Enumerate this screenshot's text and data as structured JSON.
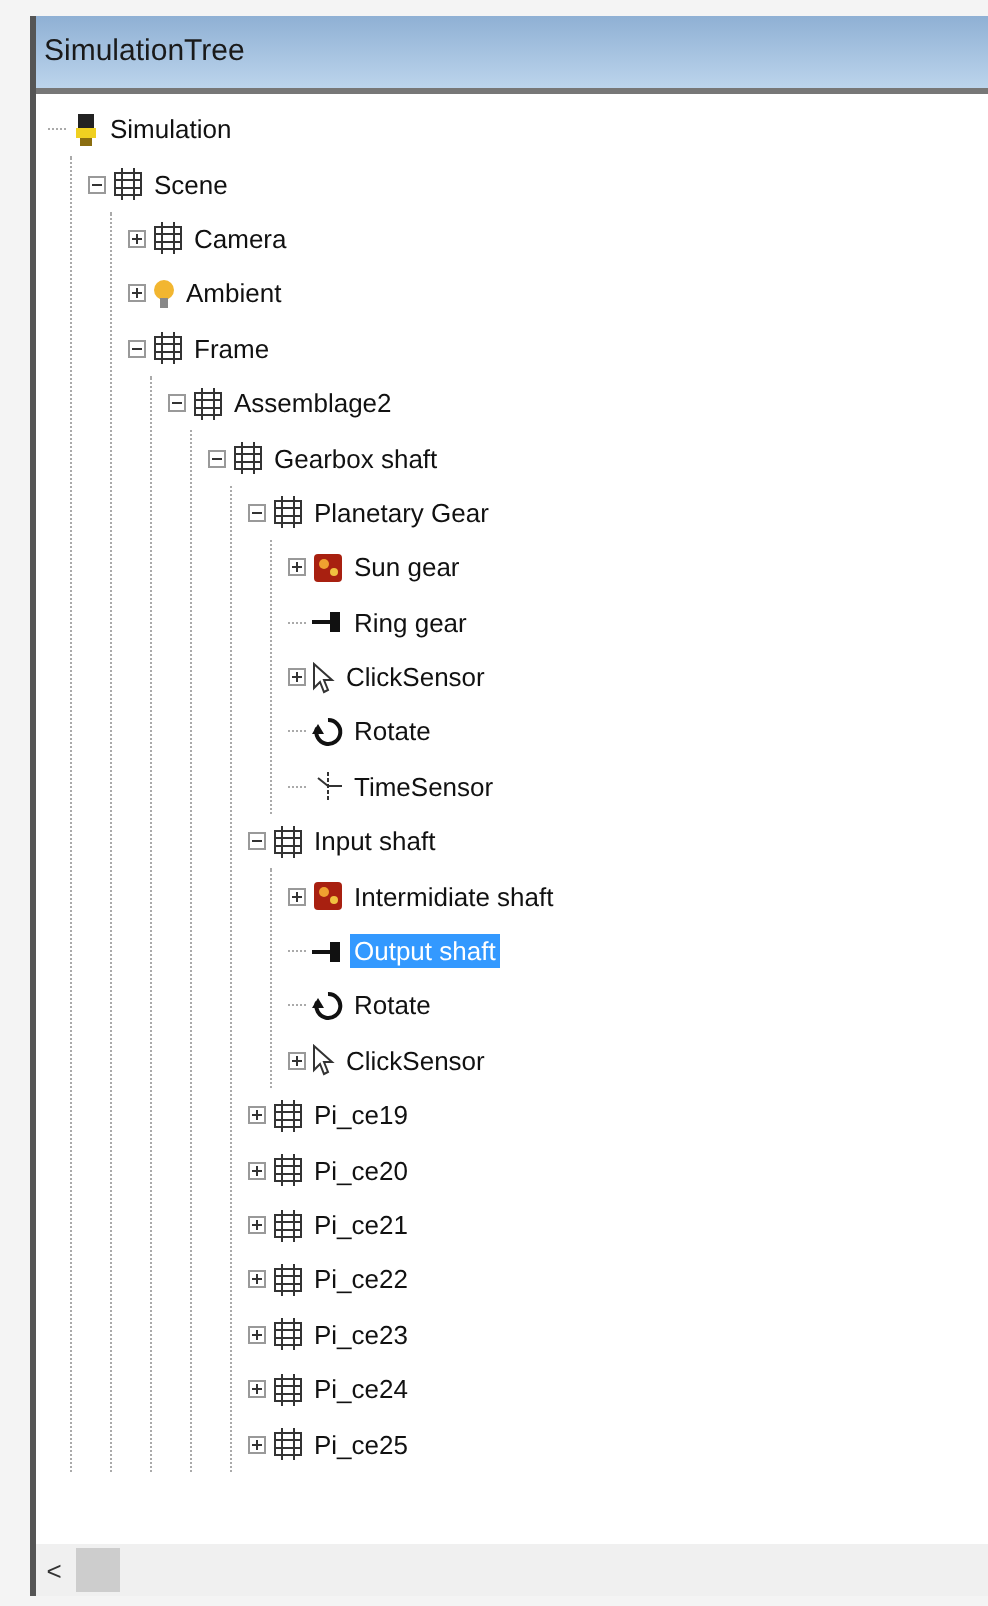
{
  "window": {
    "title": "SimulationTree"
  },
  "tree": [
    {
      "label": "Simulation",
      "kind": "simulation",
      "selected": false,
      "children": [
        {
          "label": "Scene",
          "kind": "group",
          "expanded": true,
          "selected": false,
          "children": [
            {
              "label": "Camera",
              "kind": "group",
              "expanded": false,
              "selected": false
            },
            {
              "label": "Ambient",
              "kind": "light",
              "expanded": false,
              "selected": false
            },
            {
              "label": "Frame",
              "kind": "group",
              "expanded": true,
              "selected": false,
              "children": [
                {
                  "label": "Assemblage2",
                  "kind": "group",
                  "expanded": true,
                  "selected": false,
                  "children": [
                    {
                      "label": "Gearbox shaft",
                      "kind": "group",
                      "expanded": true,
                      "selected": false,
                      "children": [
                        {
                          "label": "Planetary Gear",
                          "kind": "group",
                          "expanded": true,
                          "selected": false,
                          "children": [
                            {
                              "label": "Sun gear",
                              "kind": "part",
                              "expanded": false,
                              "selected": false
                            },
                            {
                              "label": "Ring gear",
                              "kind": "connector",
                              "selected": false
                            },
                            {
                              "label": "ClickSensor",
                              "kind": "sensor",
                              "expanded": false,
                              "selected": false
                            },
                            {
                              "label": "Rotate",
                              "kind": "rotate",
                              "selected": false
                            },
                            {
                              "label": "TimeSensor",
                              "kind": "timer",
                              "selected": false
                            }
                          ]
                        },
                        {
                          "label": "Input shaft",
                          "kind": "group",
                          "expanded": true,
                          "selected": false,
                          "children": [
                            {
                              "label": "Intermidiate shaft",
                              "kind": "part",
                              "expanded": false,
                              "selected": false
                            },
                            {
                              "label": "Output shaft",
                              "kind": "connector",
                              "selected": true
                            },
                            {
                              "label": "Rotate",
                              "kind": "rotate",
                              "selected": false
                            },
                            {
                              "label": "ClickSensor",
                              "kind": "sensor",
                              "expanded": false,
                              "selected": false
                            }
                          ]
                        },
                        {
                          "label": "Pi_ce19",
                          "kind": "group",
                          "expanded": false,
                          "selected": false
                        },
                        {
                          "label": "Pi_ce20",
                          "kind": "group",
                          "expanded": false,
                          "selected": false
                        },
                        {
                          "label": "Pi_ce21",
                          "kind": "group",
                          "expanded": false,
                          "selected": false
                        },
                        {
                          "label": "Pi_ce22",
                          "kind": "group",
                          "expanded": false,
                          "selected": false
                        },
                        {
                          "label": "Pi_ce23",
                          "kind": "group",
                          "expanded": false,
                          "selected": false
                        },
                        {
                          "label": "Pi_ce24",
                          "kind": "group",
                          "expanded": false,
                          "selected": false
                        },
                        {
                          "label": "Pi_ce25",
                          "kind": "group",
                          "expanded": false,
                          "selected": false
                        }
                      ]
                    }
                  ]
                }
              ]
            }
          ]
        }
      ]
    }
  ],
  "scrollbar": {
    "left_arrow": "<"
  }
}
